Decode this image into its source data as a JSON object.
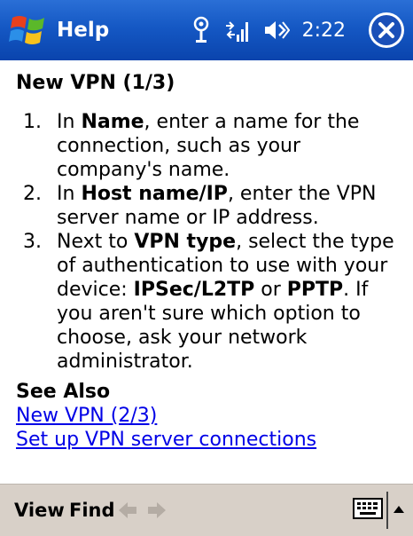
{
  "titlebar": {
    "app_title": "Help",
    "time": "2:22",
    "icons": [
      "windows-start-icon",
      "connectivity-icon",
      "signal-icon",
      "volume-icon",
      "close-icon"
    ]
  },
  "content": {
    "heading": "New VPN (1/3)",
    "steps": [
      {
        "number": "1.",
        "parts": [
          "In ",
          "Name",
          ", enter a name for the connection, such as your company's name."
        ]
      },
      {
        "number": "2.",
        "parts": [
          "In ",
          "Host name/IP",
          ", enter the VPN server name or IP address."
        ]
      },
      {
        "number": "3.",
        "parts": [
          "Next to ",
          "VPN type",
          ", select the type of authentication to use with your device: ",
          "IPSec/L2TP",
          " or ",
          "PPTP",
          ". If you aren't sure which option to choose, ask your network administrator."
        ]
      }
    ],
    "see_also": {
      "heading": "See Also",
      "links": [
        "New VPN (2/3)",
        "Set up VPN server connections"
      ]
    }
  },
  "menubar": {
    "view_label": "View",
    "find_label": "Find",
    "icons": [
      "back-arrow-icon",
      "forward-arrow-icon",
      "keyboard-icon",
      "sip-up-arrow-icon"
    ]
  },
  "colors": {
    "titlebar": "#1558c4",
    "link": "#0000e6",
    "menubar": "#d8d0c8"
  }
}
